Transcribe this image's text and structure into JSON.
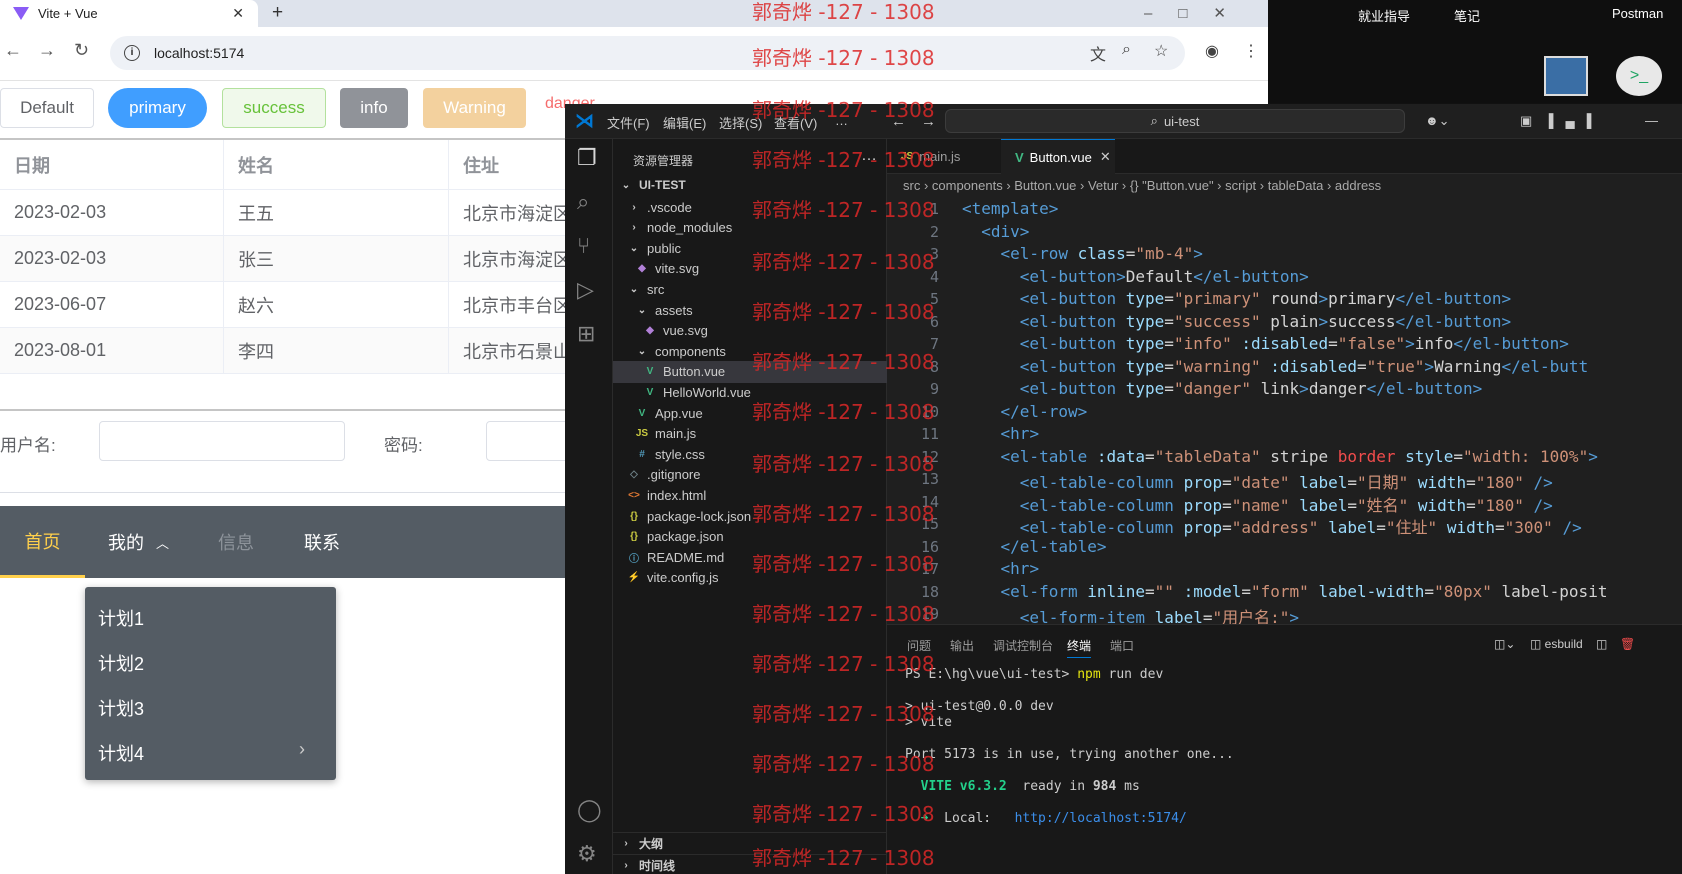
{
  "browser": {
    "tab_title": "Vite + Vue",
    "url": "localhost:5174",
    "window_controls": "–□✕"
  },
  "page": {
    "buttons": {
      "default": "Default",
      "primary": "primary",
      "success": "success",
      "info": "info",
      "warning": "Warning",
      "danger": "danger"
    },
    "table": {
      "headers": [
        "日期",
        "姓名",
        "住址"
      ],
      "rows": [
        [
          "2023-02-03",
          "王五",
          "北京市海淀区"
        ],
        [
          "2023-02-03",
          "张三",
          "北京市海淀区"
        ],
        [
          "2023-06-07",
          "赵六",
          "北京市丰台区"
        ],
        [
          "2023-08-01",
          "李四",
          "北京市石景山"
        ]
      ]
    },
    "form": {
      "username_label": "用户名:",
      "password_label": "密码:"
    },
    "menu": {
      "home": "首页",
      "mine": "我的",
      "info": "信息",
      "contact": "联系"
    },
    "submenu": [
      "计划1",
      "计划2",
      "计划3",
      "计划4"
    ]
  },
  "desktop": {
    "icons": [
      "就业指导",
      "笔记",
      "Postman"
    ]
  },
  "vscode": {
    "menu": [
      "文件(F)",
      "编辑(E)",
      "选择(S)",
      "查看(V)",
      "…"
    ],
    "search": "ui-test",
    "explorer_title": "资源管理器",
    "project": "UI-TEST",
    "tree": [
      {
        "label": ".vscode",
        "icon": "›",
        "indent": 1,
        "color": "#ccc"
      },
      {
        "label": "node_modules",
        "icon": "›",
        "indent": 1,
        "color": "#ccc"
      },
      {
        "label": "public",
        "icon": "⌄",
        "indent": 1,
        "color": "#ccc"
      },
      {
        "label": "vite.svg",
        "icon": "◆",
        "indent": 2,
        "color": "#b180d7"
      },
      {
        "label": "src",
        "icon": "⌄",
        "indent": 1,
        "color": "#ccc"
      },
      {
        "label": "assets",
        "icon": "⌄",
        "indent": 2,
        "color": "#ccc"
      },
      {
        "label": "vue.svg",
        "icon": "◆",
        "indent": 3,
        "color": "#b180d7"
      },
      {
        "label": "components",
        "icon": "⌄",
        "indent": 2,
        "color": "#ccc"
      },
      {
        "label": "Button.vue",
        "icon": "V",
        "indent": 3,
        "color": "#41b883",
        "selected": true
      },
      {
        "label": "HelloWorld.vue",
        "icon": "V",
        "indent": 3,
        "color": "#41b883"
      },
      {
        "label": "App.vue",
        "icon": "V",
        "indent": 2,
        "color": "#41b883"
      },
      {
        "label": "main.js",
        "icon": "JS",
        "indent": 2,
        "color": "#cbcb41"
      },
      {
        "label": "style.css",
        "icon": "#",
        "indent": 2,
        "color": "#519aba"
      },
      {
        "label": ".gitignore",
        "icon": "◇",
        "indent": 1,
        "color": "#6d8086"
      },
      {
        "label": "index.html",
        "icon": "<>",
        "indent": 1,
        "color": "#e37933"
      },
      {
        "label": "package-lock.json",
        "icon": "{}",
        "indent": 1,
        "color": "#cbcb41"
      },
      {
        "label": "package.json",
        "icon": "{}",
        "indent": 1,
        "color": "#cbcb41"
      },
      {
        "label": "README.md",
        "icon": "ⓘ",
        "indent": 1,
        "color": "#519aba"
      },
      {
        "label": "vite.config.js",
        "icon": "⚡",
        "indent": 1,
        "color": "#ffd700"
      }
    ],
    "outline": "大纲",
    "timeline": "时间线",
    "tabs": [
      "main.js",
      "Button.vue"
    ],
    "breadcrumb": "src › components › Button.vue › Vetur › {} \"Button.vue\" › script › tableData › address",
    "code": [
      "<template>",
      "  <div>",
      "    <el-row class=\"mb-4\">",
      "      <el-button>Default</el-button>",
      "      <el-button type=\"primary\" round>primary</el-button>",
      "      <el-button type=\"success\" plain>success</el-button>",
      "      <el-button type=\"info\" :disabled=\"false\">info</el-button>",
      "      <el-button type=\"warning\" :disabled=\"true\">Warning</el-butt",
      "      <el-button type=\"danger\" link>danger</el-button>",
      "    </el-row>",
      "    <hr>",
      "    <el-table :data=\"tableData\" stripe border style=\"width: 100%\">",
      "      <el-table-column prop=\"date\" label=\"日期\" width=\"180\" />",
      "      <el-table-column prop=\"name\" label=\"姓名\" width=\"180\" />",
      "      <el-table-column prop=\"address\" label=\"住址\" width=\"300\" />",
      "    </el-table>",
      "    <hr>",
      "    <el-form inline=\"\" :model=\"form\" label-width=\"80px\" label-posit",
      "      <el-form-item label=\"用户名:\">"
    ],
    "panel_tabs": [
      "问题",
      "输出",
      "调试控制台",
      "终端",
      "端口"
    ],
    "terminal_shell": "esbuild",
    "terminal": [
      "PS E:\\hg\\vue\\ui-test> npm run dev",
      "",
      "> ui-test@0.0.0 dev",
      "> vite",
      "",
      "Port 5173 is in use, trying another one...",
      "",
      "  VITE v6.3.2  ready in 984 ms",
      "",
      "  ➜  Local:   http://localhost:5174/"
    ]
  },
  "watermark": "郭奇烨 -127 - 1308",
  "colors": {
    "vue_green": "#41b883",
    "el_primary": "#409eff",
    "menu_active": "#ffd04b"
  }
}
